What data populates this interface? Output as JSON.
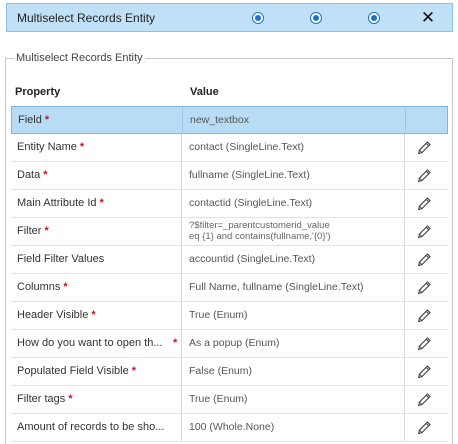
{
  "topbar": {
    "title": "Multiselect Records Entity",
    "radios": [
      "radio-1",
      "radio-2",
      "radio-3"
    ],
    "close_icon": "close-icon",
    "close_glyph": "✕"
  },
  "section": {
    "legend": "Multiselect Records Entity",
    "header_property": "Property",
    "header_value": "Value"
  },
  "colors": {
    "selected_row": "#b9dcf6",
    "required": "#c4161c",
    "radio": "#1a73c9"
  },
  "required_marker": "*",
  "rows": [
    {
      "property": "Field",
      "required": true,
      "value": "new_textbox",
      "selected": true,
      "editable": false
    },
    {
      "property": "Entity Name",
      "required": true,
      "value": "contact (SingleLine.Text)",
      "editable": true
    },
    {
      "property": "Data",
      "required": true,
      "value": "fullname (SingleLine.Text)",
      "editable": true
    },
    {
      "property": "Main Attribute Id",
      "required": true,
      "value": "contactid (SingleLine.Text)",
      "editable": true
    },
    {
      "property": "Filter",
      "required": true,
      "value_line1": "?$filter=_parentcustomerid_value",
      "value_line2": "eq {1} and contains(fullname,'{0}')",
      "editable": true
    },
    {
      "property": "Field Filter Values",
      "required": false,
      "value": "accountid (SingleLine.Text)",
      "editable": true
    },
    {
      "property": "Columns",
      "required": true,
      "value": "Full Name, fullname (SingleLine.Text)",
      "editable": true
    },
    {
      "property": "Header Visible",
      "required": true,
      "value": "True (Enum)",
      "editable": true
    },
    {
      "property": "How do you want to open th...",
      "required": true,
      "value": "As a popup (Enum)",
      "editable": true
    },
    {
      "property": "Populated Field Visible",
      "required": true,
      "value": "False (Enum)",
      "editable": true
    },
    {
      "property": "Filter tags",
      "required": true,
      "value": "True (Enum)",
      "editable": true
    },
    {
      "property": "Amount of records to be sho...",
      "required": false,
      "value": "100 (Whole.None)",
      "editable": true
    }
  ]
}
